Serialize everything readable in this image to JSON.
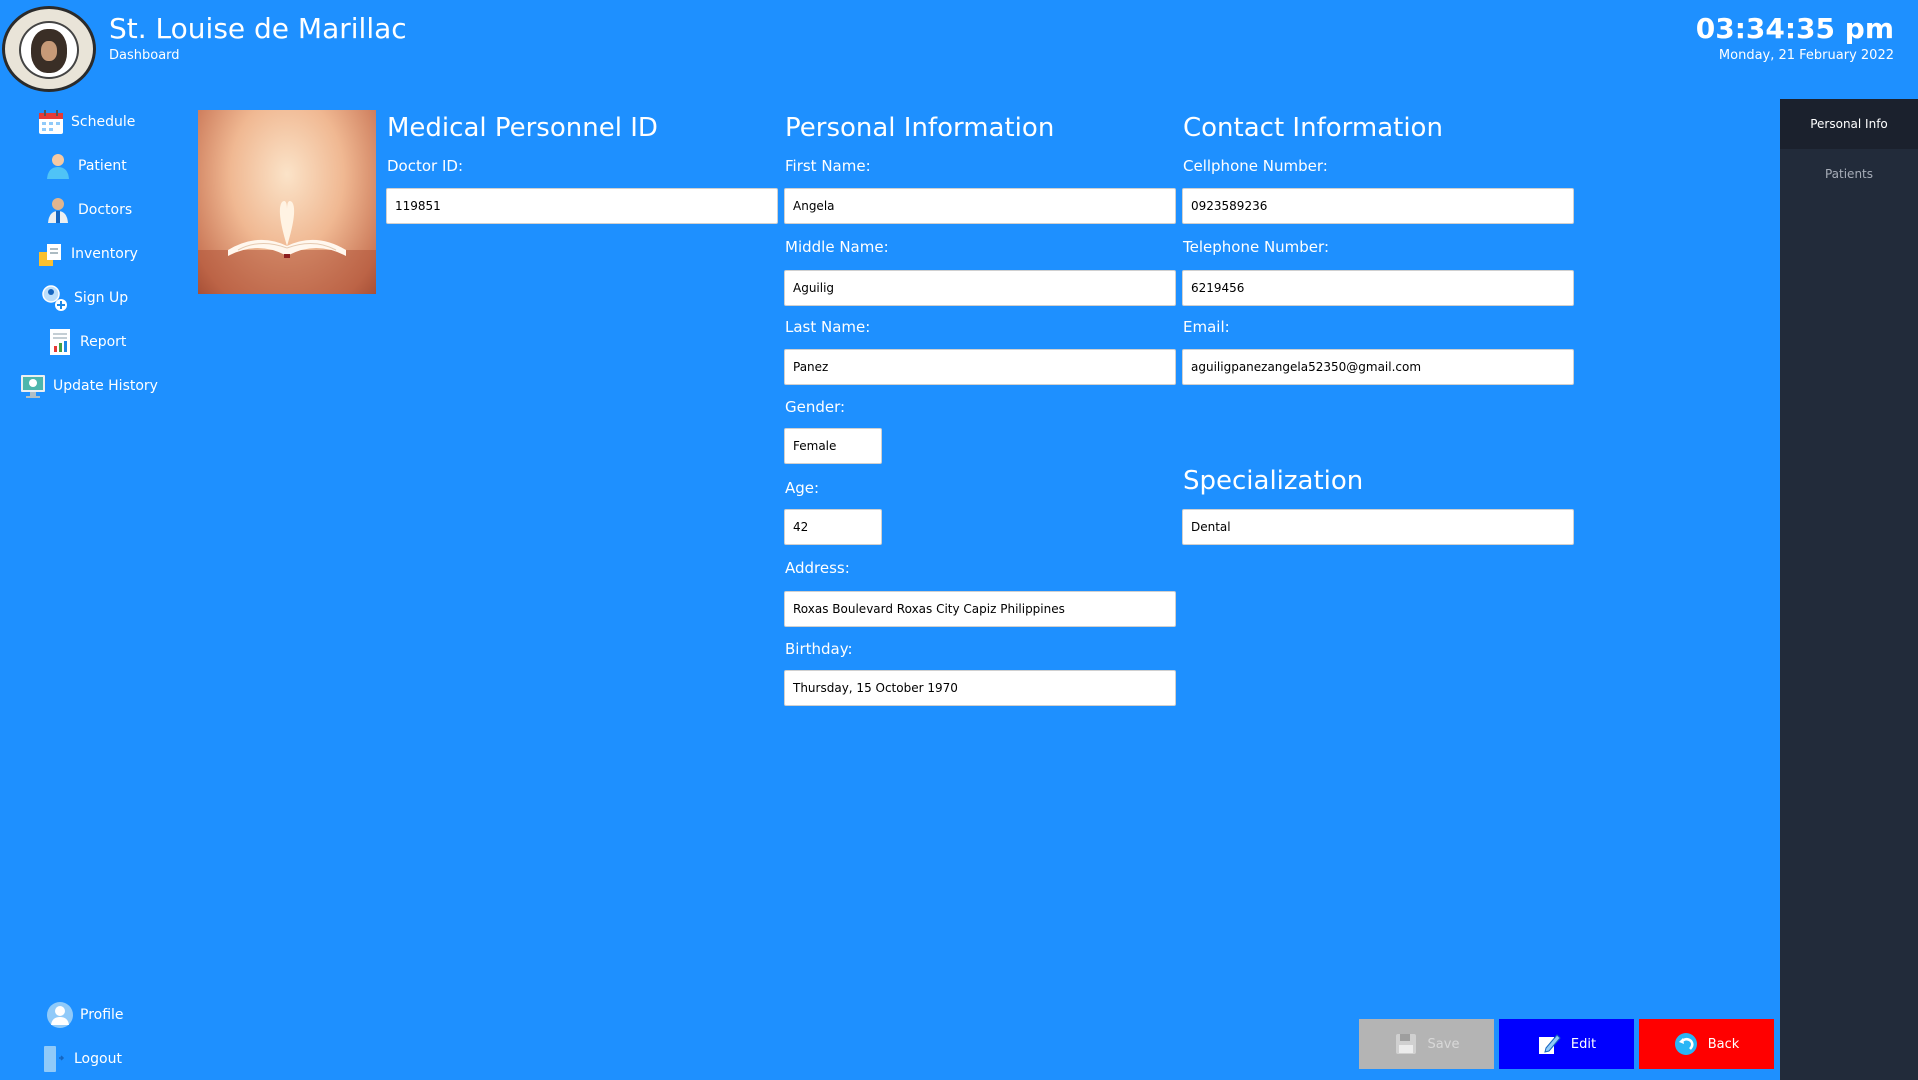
{
  "header": {
    "app_title": "St. Louise de Marillac",
    "subtitle": "Dashboard",
    "time": "03:34:35 pm",
    "date": "Monday, 21 February 2022"
  },
  "sidebar": {
    "items": [
      {
        "label": "Schedule",
        "icon": "calendar-icon"
      },
      {
        "label": "Patient",
        "icon": "patient-icon"
      },
      {
        "label": "Doctors",
        "icon": "doctor-icon"
      },
      {
        "label": "Inventory",
        "icon": "inventory-icon"
      },
      {
        "label": "Sign Up",
        "icon": "add-user-icon"
      },
      {
        "label": "Report",
        "icon": "report-icon"
      },
      {
        "label": "Update History",
        "icon": "history-icon"
      }
    ],
    "bottom": [
      {
        "label": "Profile",
        "icon": "profile-icon"
      },
      {
        "label": "Logout",
        "icon": "logout-icon"
      }
    ]
  },
  "medical_id": {
    "title": "Medical Personnel ID",
    "doctor_id_label": "Doctor ID:",
    "doctor_id_value": "119851"
  },
  "personal": {
    "title": "Personal Information",
    "first_name_label": "First Name:",
    "first_name_value": "Angela",
    "middle_name_label": "Middle Name:",
    "middle_name_value": "Aguilig",
    "last_name_label": "Last Name:",
    "last_name_value": "Panez",
    "gender_label": "Gender:",
    "gender_value": "Female",
    "age_label": "Age:",
    "age_value": "42",
    "address_label": "Address:",
    "address_value": "Roxas Boulevard Roxas City Capiz Philippines",
    "birthday_label": "Birthday:",
    "birthday_value": "Thursday, 15 October 1970"
  },
  "contact": {
    "title": "Contact Information",
    "cellphone_label": "Cellphone Number:",
    "cellphone_value": "0923589236",
    "telephone_label": "Telephone Number:",
    "telephone_value": "6219456",
    "email_label": "Email:",
    "email_value": "aguiligpanezangela52350@gmail.com"
  },
  "specialization": {
    "title": "Specialization",
    "value": "Dental"
  },
  "right_tabs": {
    "personal_info": "Personal Info",
    "patients": "Patients"
  },
  "actions": {
    "save": "Save",
    "edit": "Edit",
    "back": "Back"
  },
  "colors": {
    "background": "#1e90ff",
    "right_panel": "#222b3a",
    "save_disabled": "#b4b4b4",
    "edit": "#0000ff",
    "back": "#ff0000"
  }
}
